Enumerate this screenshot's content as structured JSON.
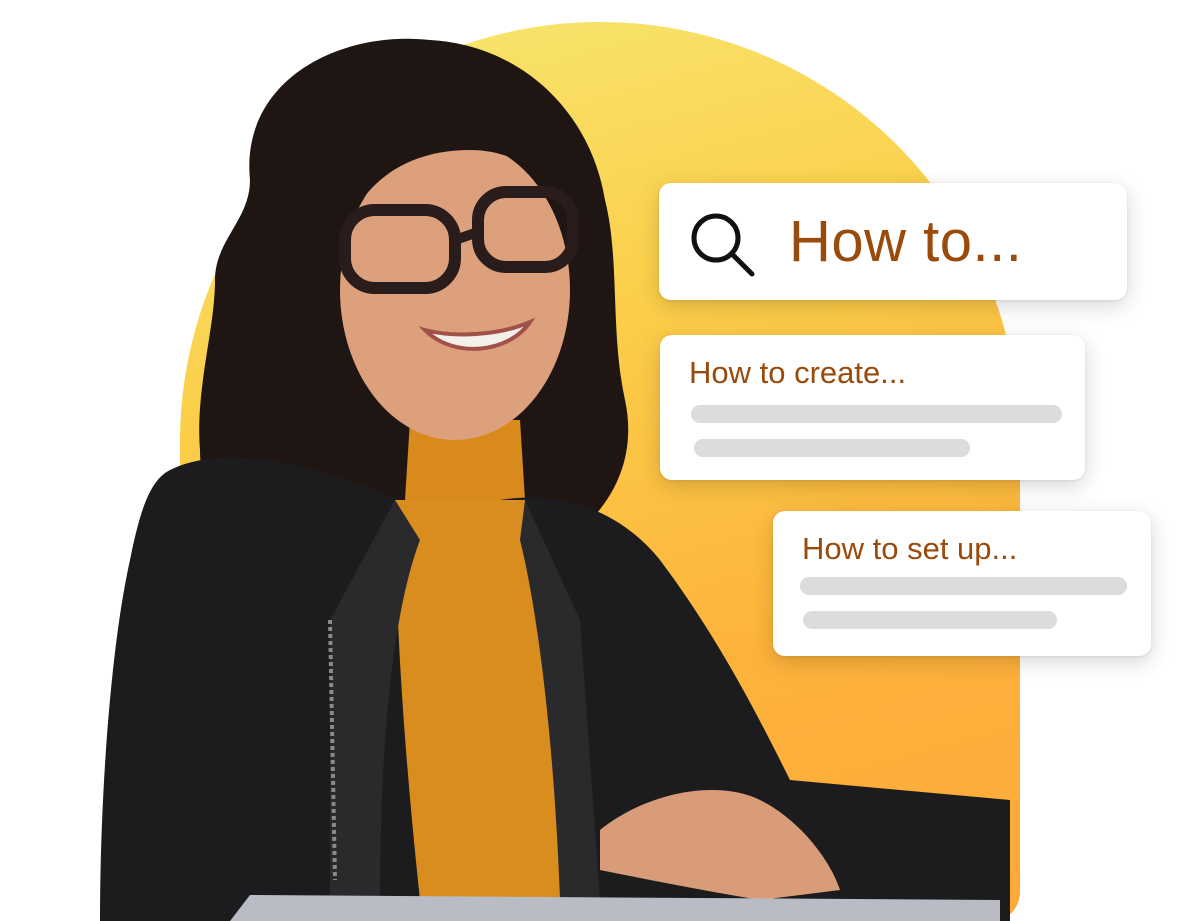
{
  "search": {
    "icon": "search-icon",
    "query": "How to..."
  },
  "results": [
    {
      "title": "How to create..."
    },
    {
      "title": "How to set up..."
    }
  ],
  "colors": {
    "accent_text": "#9a4a0b",
    "blob_top": "#f7e874",
    "blob_bottom": "#fda93a",
    "placeholder_line": "#dcdcdc"
  }
}
